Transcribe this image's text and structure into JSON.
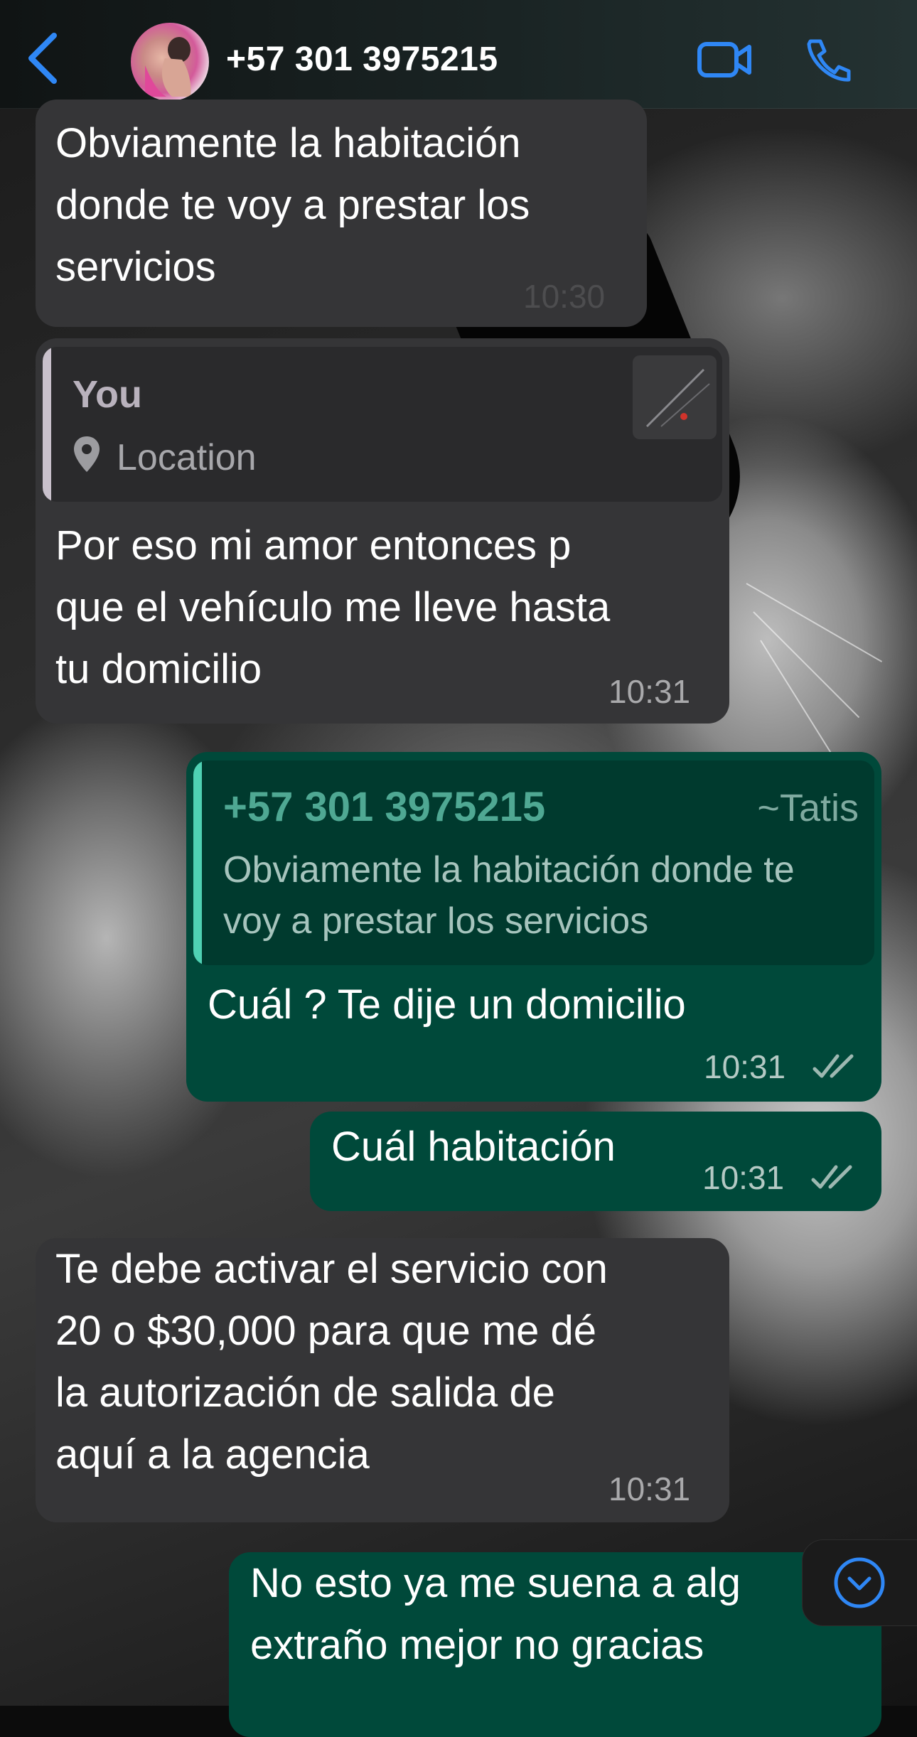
{
  "header": {
    "contact": "+57 301 3975215",
    "accent_color": "#2f87f5"
  },
  "messages": [
    {
      "text": "Obviamente la habitación\ndonde te voy a prestar los\nservicios",
      "time": "10:30"
    },
    {
      "quote_author": "You",
      "quote_text": "Location",
      "text": "Por eso mi amor entonces p\nque el vehículo me lleve hasta\ntu domicilio",
      "time": "10:31"
    },
    {
      "quote_author": "+57 301 3975215",
      "quote_alias": "~Tatis",
      "quote_text": "Obviamente la habitación donde te\nvoy a prestar los servicios",
      "text": "Cuál ? Te dije un domicilio",
      "time": "10:31"
    },
    {
      "text": "Cuál habitación",
      "time": "10:31"
    },
    {
      "text": "Te debe activar el servicio con\n20 o $30,000 para que me dé\nla autorización de salida de\naquí a la agencia",
      "time": "10:31"
    },
    {
      "text": "No esto ya me suena a alg\nextraño mejor no gracias"
    }
  ],
  "icons": {
    "back": "chevron-left-icon",
    "video": "video-camera-icon",
    "call": "phone-icon",
    "pin": "location-pin-icon",
    "read": "double-check-icon",
    "scroll": "chevron-down-circle-icon"
  }
}
